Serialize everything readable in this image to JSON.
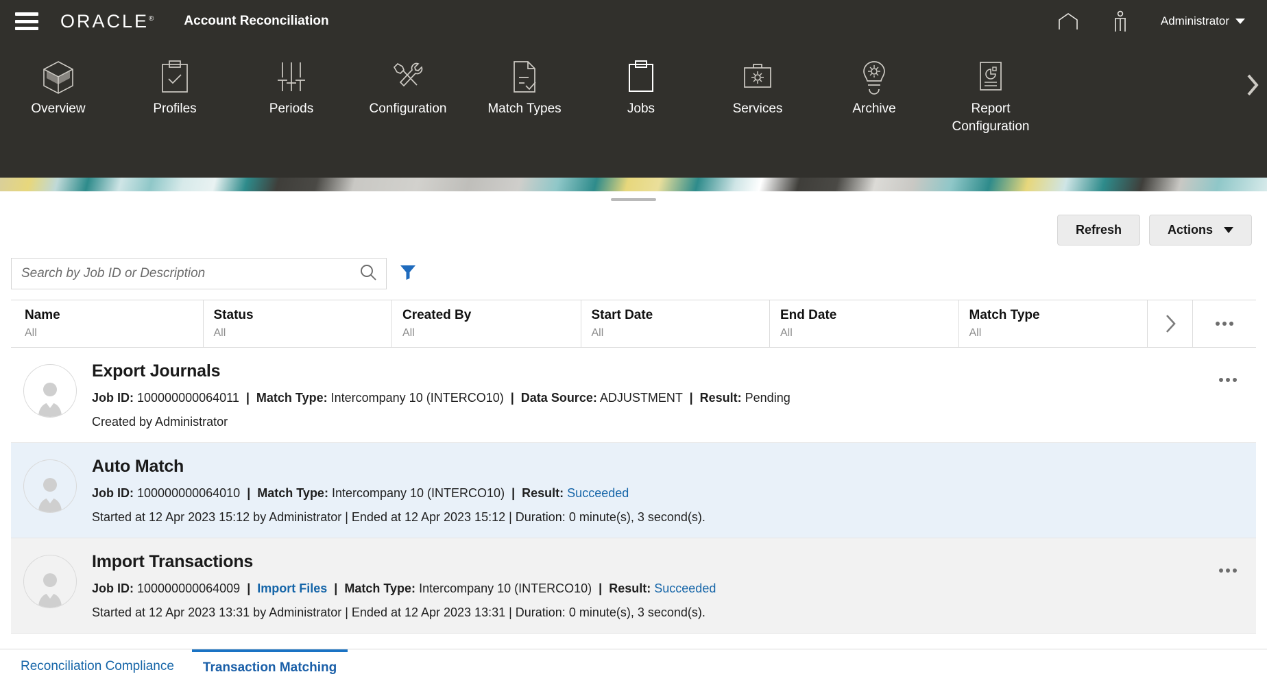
{
  "header": {
    "menu_icon": "hamburger-icon",
    "brand": "ORACLE",
    "app_title": "Account Reconciliation",
    "home_icon": "home-icon",
    "accessibility_icon": "accessibility-person-icon",
    "user_label": "Administrator"
  },
  "nav": {
    "items": [
      {
        "label": "Overview",
        "icon": "cube-icon",
        "active": false
      },
      {
        "label": "Profiles",
        "icon": "clipboard-check-icon",
        "active": false
      },
      {
        "label": "Periods",
        "icon": "sliders-icon",
        "active": false
      },
      {
        "label": "Configuration",
        "icon": "tools-icon",
        "active": false
      },
      {
        "label": "Match Types",
        "icon": "document-check-icon",
        "active": false
      },
      {
        "label": "Jobs",
        "icon": "clipboard-icon",
        "active": true
      },
      {
        "label": "Services",
        "icon": "briefcase-gear-icon",
        "active": false
      },
      {
        "label": "Archive",
        "icon": "lightbulb-gear-icon",
        "active": false
      },
      {
        "label": "Report Configuration",
        "icon": "report-piechart-icon",
        "active": false
      }
    ],
    "next_icon": "chevron-right-icon"
  },
  "toolbar": {
    "refresh_label": "Refresh",
    "actions_label": "Actions",
    "actions_caret_icon": "caret-down-icon"
  },
  "search": {
    "placeholder": "Search by Job ID or Description",
    "value": "",
    "search_icon": "search-icon",
    "filter_icon": "filter-funnel-icon",
    "filter_color": "#1f6bbd"
  },
  "table": {
    "columns": [
      {
        "label": "Name",
        "filter": "All"
      },
      {
        "label": "Status",
        "filter": "All"
      },
      {
        "label": "Created By",
        "filter": "All"
      },
      {
        "label": "Start Date",
        "filter": "All"
      },
      {
        "label": "End Date",
        "filter": "All"
      },
      {
        "label": "Match Type",
        "filter": "All"
      }
    ],
    "expand_icon": "chevron-right-icon",
    "more_icon": "overflow-menu-icon"
  },
  "jobs": [
    {
      "name": "Export Journals",
      "job_id_label": "Job ID:",
      "job_id": "100000000064011",
      "match_type_label": "Match Type:",
      "match_type": "Intercompany 10 (INTERCO10)",
      "data_source_label": "Data Source:",
      "data_source": "ADJUSTMENT",
      "result_label": "Result:",
      "result": "Pending",
      "result_is_link": false,
      "sub": "Created by Administrator",
      "import_files_label": null,
      "row_style": "plain",
      "has_more": true
    },
    {
      "name": "Auto Match",
      "job_id_label": "Job ID:",
      "job_id": "100000000064010",
      "match_type_label": "Match Type:",
      "match_type": "Intercompany 10 (INTERCO10)",
      "data_source_label": null,
      "data_source": null,
      "result_label": "Result:",
      "result": "Succeeded",
      "result_is_link": true,
      "sub": "Started at 12 Apr 2023 15:12 by Administrator  | Ended at 12 Apr 2023 15:12 | Duration: 0 minute(s), 3 second(s).",
      "import_files_label": null,
      "row_style": "selected",
      "has_more": false
    },
    {
      "name": "Import Transactions",
      "job_id_label": "Job ID:",
      "job_id": "100000000064009",
      "match_type_label": "Match Type:",
      "match_type": "Intercompany 10 (INTERCO10)",
      "data_source_label": null,
      "data_source": null,
      "result_label": "Result:",
      "result": "Succeeded",
      "result_is_link": true,
      "sub": "Started at 12 Apr 2023 13:31 by Administrator  | Ended at 12 Apr 2023 13:31 | Duration: 0 minute(s), 3 second(s).",
      "import_files_label": "Import Files",
      "row_style": "alt",
      "has_more": true
    }
  ],
  "bottom_tabs": [
    {
      "label": "Reconciliation Compliance",
      "active": false
    },
    {
      "label": "Transaction Matching",
      "active": true
    }
  ],
  "colors": {
    "header_bg": "#31302c",
    "link": "#1565a8",
    "selected_row": "#e9f1f9",
    "alt_row": "#f2f2f2",
    "active_tab_border": "#1a73c4"
  }
}
